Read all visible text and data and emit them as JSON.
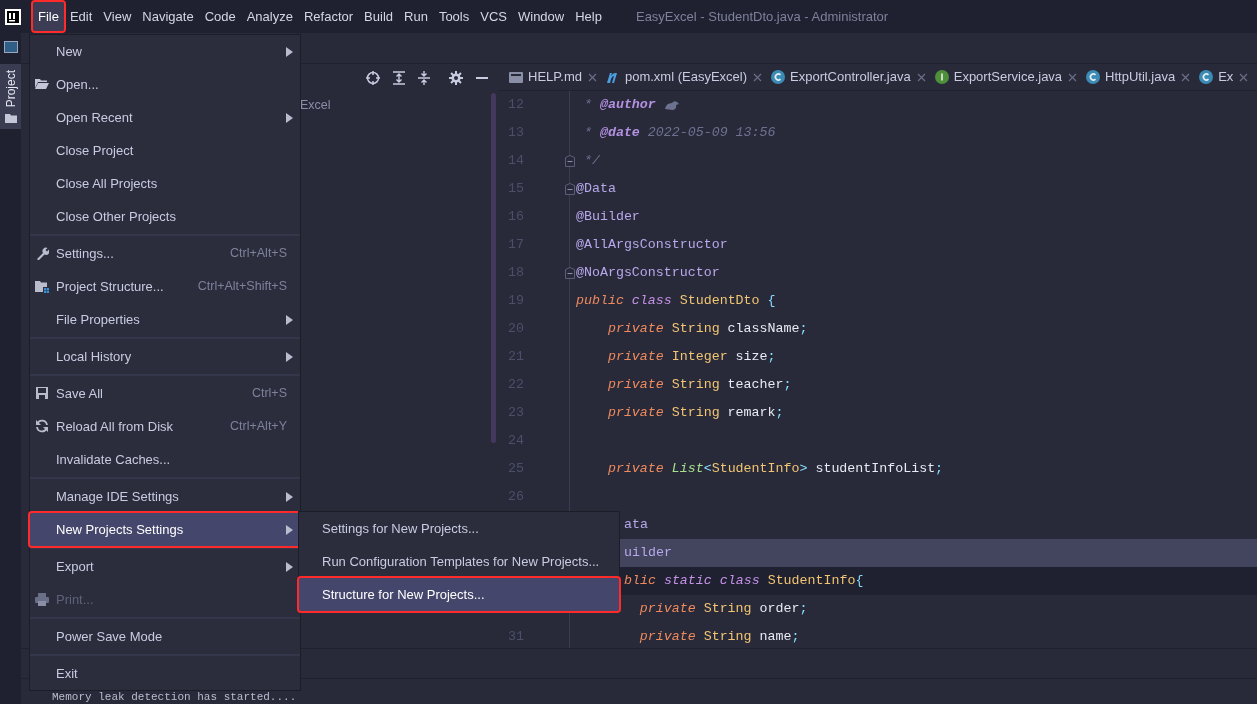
{
  "menu_bar": {
    "items": [
      {
        "label": "File",
        "selected": true,
        "highlighted": true
      },
      {
        "label": "Edit",
        "selected": false,
        "highlighted": false
      },
      {
        "label": "View",
        "selected": false,
        "highlighted": false
      },
      {
        "label": "Navigate",
        "selected": false,
        "highlighted": false
      },
      {
        "label": "Code",
        "selected": false,
        "highlighted": false
      },
      {
        "label": "Analyze",
        "selected": false,
        "highlighted": false
      },
      {
        "label": "Refactor",
        "selected": false,
        "highlighted": false
      },
      {
        "label": "Build",
        "selected": false,
        "highlighted": false
      },
      {
        "label": "Run",
        "selected": false,
        "highlighted": false
      },
      {
        "label": "Tools",
        "selected": false,
        "highlighted": false
      },
      {
        "label": "VCS",
        "selected": false,
        "highlighted": false
      },
      {
        "label": "Window",
        "selected": false,
        "highlighted": false
      },
      {
        "label": "Help",
        "selected": false,
        "highlighted": false
      }
    ],
    "window_title": "EasyExcel - StudentDto.java - Administrator"
  },
  "tool_window_stripe": {
    "tab": {
      "label": "Project",
      "selected": true
    }
  },
  "project_panel": {
    "tree_text": "Excel"
  },
  "editor_tabs": [
    {
      "label": "HELP.md",
      "kind": "markdown"
    },
    {
      "label": "pom.xml (EasyExcel)",
      "kind": "maven"
    },
    {
      "label": "ExportController.java",
      "kind": "class"
    },
    {
      "label": "ExportService.java",
      "kind": "interface"
    },
    {
      "label": "HttpUtil.java",
      "kind": "class"
    },
    {
      "label": "Ex",
      "kind": "class"
    }
  ],
  "code_lines": [
    {
      "number": "12",
      "tokens": [
        {
          "text": " * ",
          "kind": "comment"
        },
        {
          "text": "@author",
          "kind": "doctag"
        },
        {
          "kind": "icon"
        }
      ]
    },
    {
      "number": "13",
      "tokens": [
        {
          "text": " * ",
          "kind": "comment"
        },
        {
          "text": "@date",
          "kind": "doctag"
        },
        {
          "text": " 2022-05-09 13:56",
          "kind": "comment"
        }
      ]
    },
    {
      "number": "14",
      "fold": true,
      "tokens": [
        {
          "text": " */",
          "kind": "comment"
        }
      ]
    },
    {
      "number": "15",
      "fold": true,
      "tokens": [
        {
          "text": "@Data",
          "kind": "annotation"
        }
      ]
    },
    {
      "number": "16",
      "tokens": [
        {
          "text": "@Builder",
          "kind": "annotation"
        }
      ]
    },
    {
      "number": "17",
      "tokens": [
        {
          "text": "@AllArgsConstructor",
          "kind": "annotation"
        }
      ]
    },
    {
      "number": "18",
      "fold": true,
      "tokens": [
        {
          "text": "@NoArgsConstructor",
          "kind": "annotation"
        }
      ]
    },
    {
      "number": "19",
      "tokens": [
        {
          "text": "public",
          "kind": "keyword"
        },
        {
          "text": " class",
          "kind": "keyword2"
        },
        {
          "text": " StudentDto ",
          "kind": "type"
        },
        {
          "text": "{",
          "kind": "punct"
        }
      ]
    },
    {
      "number": "20",
      "tokens": [
        {
          "text": "    private",
          "kind": "keyword"
        },
        {
          "text": " String",
          "kind": "type"
        },
        {
          "text": " className",
          "kind": "plain"
        },
        {
          "text": ";",
          "kind": "punct"
        }
      ]
    },
    {
      "number": "21",
      "tokens": [
        {
          "text": "    private",
          "kind": "keyword"
        },
        {
          "text": " Integer",
          "kind": "type"
        },
        {
          "text": " size",
          "kind": "plain"
        },
        {
          "text": ";",
          "kind": "punct"
        }
      ]
    },
    {
      "number": "22",
      "tokens": [
        {
          "text": "    private",
          "kind": "keyword"
        },
        {
          "text": " String",
          "kind": "type"
        },
        {
          "text": " teacher",
          "kind": "plain"
        },
        {
          "text": ";",
          "kind": "punct"
        }
      ]
    },
    {
      "number": "23",
      "tokens": [
        {
          "text": "    private",
          "kind": "keyword"
        },
        {
          "text": " String",
          "kind": "type"
        },
        {
          "text": " remark",
          "kind": "plain"
        },
        {
          "text": ";",
          "kind": "punct"
        }
      ]
    },
    {
      "number": "24"
    },
    {
      "number": "25",
      "tokens": [
        {
          "text": "    private",
          "kind": "keyword"
        },
        {
          "text": " List",
          "kind": "generic"
        },
        {
          "text": "<",
          "kind": "punct"
        },
        {
          "text": "StudentInfo",
          "kind": "type"
        },
        {
          "text": ">",
          "kind": "punct"
        },
        {
          "text": " studentInfoList",
          "kind": "plain"
        },
        {
          "text": ";",
          "kind": "punct"
        }
      ]
    },
    {
      "number": "26"
    },
    {
      "covered": true,
      "tokens": [
        {
          "text": "ata",
          "kind": "annotation"
        }
      ]
    },
    {
      "covered": true,
      "caret": true,
      "tokens": [
        {
          "text": "uilder",
          "kind": "annotation"
        }
      ]
    },
    {
      "covered": true,
      "shaded": true,
      "tokens": [
        {
          "text": "blic",
          "kind": "keyword"
        },
        {
          "text": " static",
          "kind": "keyword2"
        },
        {
          "text": " class",
          "kind": "keyword2"
        },
        {
          "text": " StudentInfo",
          "kind": "type"
        },
        {
          "text": "{",
          "kind": "punct"
        }
      ]
    },
    {
      "tokens": [
        {
          "text": "        private",
          "kind": "keyword"
        },
        {
          "text": " String",
          "kind": "type"
        },
        {
          "text": " order",
          "kind": "plain"
        },
        {
          "text": ";",
          "kind": "punct"
        }
      ]
    },
    {
      "number": "31",
      "tokens": [
        {
          "text": "        private",
          "kind": "keyword"
        },
        {
          "text": " String",
          "kind": "type"
        },
        {
          "text": " name",
          "kind": "plain"
        },
        {
          "text": ";",
          "kind": "punct"
        }
      ]
    }
  ],
  "console": {
    "text": "Memory leak detection has started...."
  },
  "file_menu": [
    {
      "kind": "plain",
      "label": "New",
      "submenu": true,
      "selected": false,
      "disabled": false,
      "highlighted": false
    },
    {
      "kind": "open",
      "label": "Open...",
      "selected": false,
      "disabled": false,
      "highlighted": false
    },
    {
      "kind": "plain",
      "label": "Open Recent",
      "submenu": true,
      "selected": false,
      "disabled": false,
      "highlighted": false
    },
    {
      "kind": "plain",
      "label": "Close Project",
      "selected": false,
      "disabled": false,
      "highlighted": false
    },
    {
      "kind": "plain",
      "label": "Close All Projects",
      "selected": false,
      "disabled": false,
      "highlighted": false
    },
    {
      "kind": "plain",
      "label": "Close Other Projects",
      "selected": false,
      "disabled": false,
      "highlighted": false
    },
    {
      "kind": "separator"
    },
    {
      "kind": "settings",
      "label": "Settings...",
      "shortcut": "Ctrl+Alt+S",
      "selected": false,
      "disabled": false,
      "highlighted": false
    },
    {
      "kind": "structure",
      "label": "Project Structure...",
      "shortcut": "Ctrl+Alt+Shift+S",
      "selected": false,
      "disabled": false,
      "highlighted": false
    },
    {
      "kind": "plain",
      "label": "File Properties",
      "submenu": true,
      "selected": false,
      "disabled": false,
      "highlighted": false
    },
    {
      "kind": "separator"
    },
    {
      "kind": "plain",
      "label": "Local History",
      "submenu": true,
      "selected": false,
      "disabled": false,
      "highlighted": false
    },
    {
      "kind": "separator"
    },
    {
      "kind": "save",
      "label": "Save All",
      "shortcut": "Ctrl+S",
      "selected": false,
      "disabled": false,
      "highlighted": false
    },
    {
      "kind": "reload",
      "label": "Reload All from Disk",
      "shortcut": "Ctrl+Alt+Y",
      "selected": false,
      "disabled": false,
      "highlighted": false
    },
    {
      "kind": "plain",
      "label": "Invalidate Caches...",
      "selected": false,
      "disabled": false,
      "highlighted": false
    },
    {
      "kind": "separator"
    },
    {
      "kind": "plain",
      "label": "Manage IDE Settings",
      "submenu": true,
      "selected": false,
      "disabled": false,
      "highlighted": false
    },
    {
      "kind": "plain",
      "label": "New Projects Settings",
      "submenu": true,
      "selected": true,
      "disabled": false,
      "highlighted": true
    },
    {
      "kind": "separator"
    },
    {
      "kind": "plain",
      "label": "Export",
      "submenu": true,
      "selected": false,
      "disabled": false,
      "highlighted": false
    },
    {
      "kind": "print",
      "label": "Print...",
      "selected": false,
      "disabled": true,
      "highlighted": false
    },
    {
      "kind": "separator"
    },
    {
      "kind": "plain",
      "label": "Power Save Mode",
      "selected": false,
      "disabled": false,
      "highlighted": false
    },
    {
      "kind": "separator"
    },
    {
      "kind": "plain",
      "label": "Exit",
      "selected": false,
      "disabled": false,
      "highlighted": false
    }
  ],
  "submenu": [
    {
      "label": "Settings for New Projects...",
      "selected": false,
      "highlighted": false
    },
    {
      "label": "Run Configuration Templates for New Projects...",
      "selected": false,
      "highlighted": false
    },
    {
      "label": "Structure for New Projects...",
      "selected": true,
      "highlighted": true
    }
  ]
}
